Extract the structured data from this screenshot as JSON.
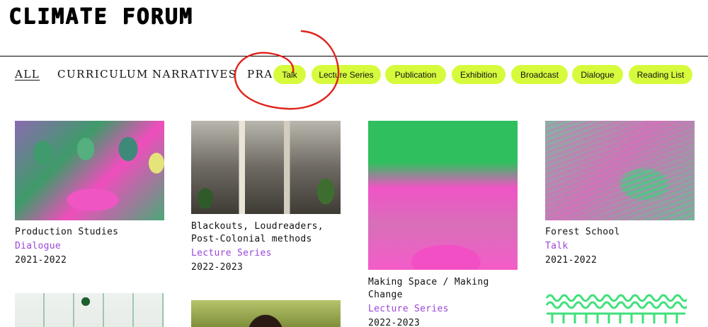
{
  "header": {
    "logo": "CLIMATE FORUM"
  },
  "nav": {
    "items": [
      "ALL",
      "CURRICULUM",
      "NARRATIVES",
      "PRAC"
    ],
    "active": "ALL"
  },
  "filters": {
    "pills": [
      "Talk",
      "Lecture Series",
      "Publication",
      "Exhibition",
      "Broadcast",
      "Dialogue",
      "Reading List"
    ],
    "accent": "#d6fb3c"
  },
  "annotation": {
    "color": "#e0221b",
    "shape": "hand-drawn circle"
  },
  "cards": [
    {
      "title": [
        "Production Studies"
      ],
      "type": "Dialogue",
      "year": "2021-2022"
    },
    {
      "title": [
        "Blackouts, Loudreaders,",
        "Post-Colonial methods"
      ],
      "type": "Lecture Series",
      "year": "2022-2023"
    },
    {
      "title": [
        "Making Space / Making",
        "Change"
      ],
      "type": "Lecture Series",
      "year": "2022-2023"
    },
    {
      "title": [
        "Forest School"
      ],
      "type": "Talk",
      "year": "2021-2022"
    }
  ],
  "colors": {
    "type_link": "#9b46d8",
    "pink": "#f04dbd",
    "green": "#2fbf5e"
  }
}
